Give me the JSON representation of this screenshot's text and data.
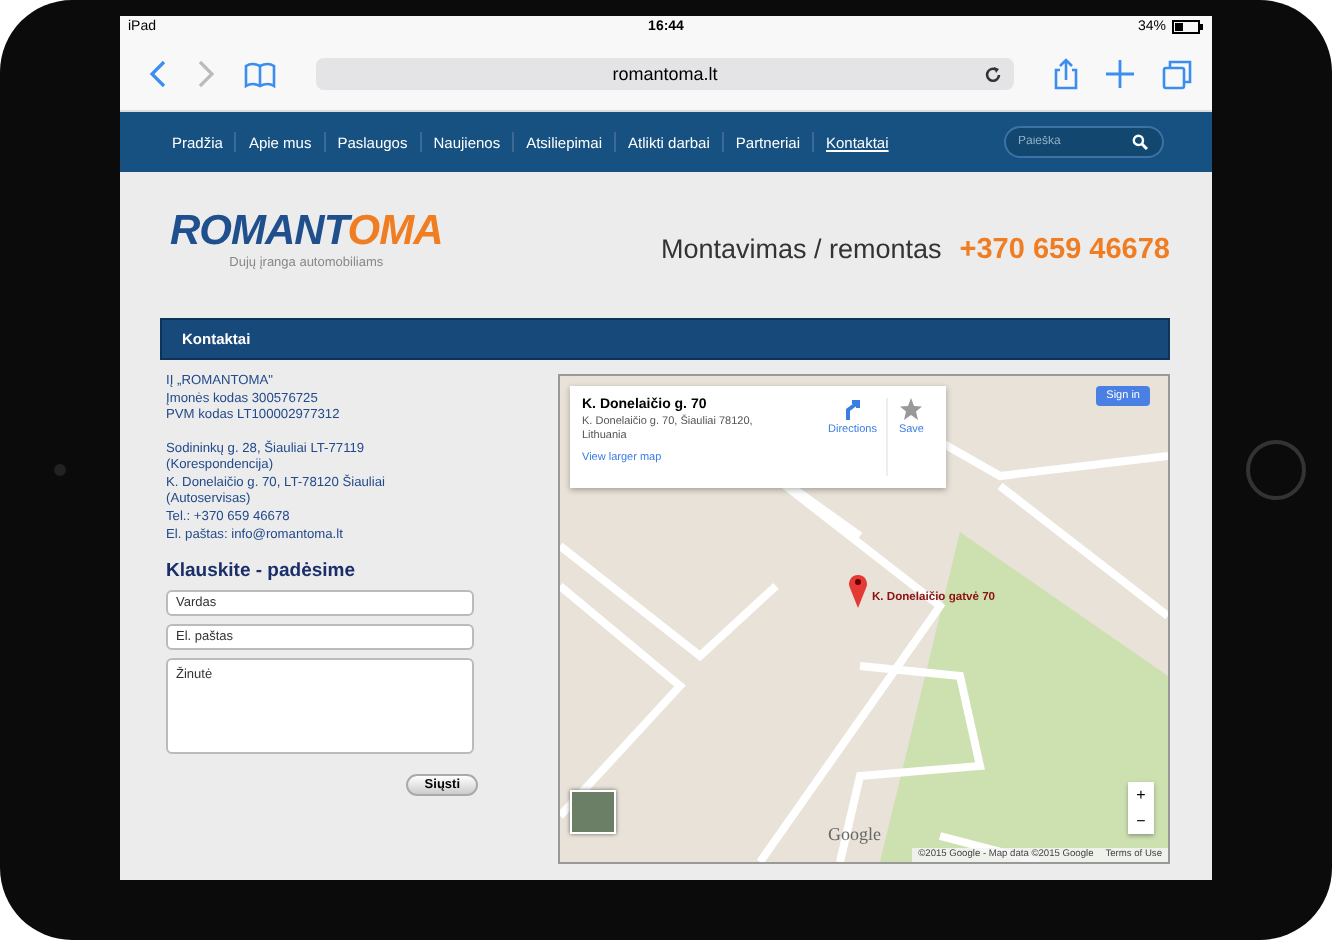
{
  "status_bar": {
    "device": "iPad",
    "time": "16:44",
    "battery": "34%"
  },
  "browser": {
    "url": "romantoma.lt"
  },
  "nav": {
    "items": [
      {
        "label": "Pradžia",
        "selected": false
      },
      {
        "label": "Apie mus",
        "selected": false
      },
      {
        "label": "Paslaugos",
        "selected": false
      },
      {
        "label": "Naujienos",
        "selected": false
      },
      {
        "label": "Atsiliepimai",
        "selected": false
      },
      {
        "label": "Atlikti darbai",
        "selected": false
      },
      {
        "label": "Partneriai",
        "selected": false
      },
      {
        "label": "Kontaktai",
        "selected": true
      }
    ],
    "search": {
      "placeholder": "Paieška"
    }
  },
  "header": {
    "logo": {
      "text_primary": "ROMANT",
      "text_accent": "OMA",
      "tagline": "Dujų įranga automobiliams"
    },
    "slogan": "Montavimas / remontas",
    "phone": "+370 659 46678"
  },
  "section": {
    "title": "Kontaktai"
  },
  "contacts": [
    [
      "IĮ „ROMANTOMA\"",
      "Įmonės kodas 300576725",
      "PVM kodas LT100002977312"
    ],
    [
      "Sodininkų g. 28, Šiauliai LT-77119",
      "(Korespondencija)",
      "K. Donelaičio g. 70, LT-78120 Šiauliai",
      "(Autoservisas)",
      "Tel.: +370 659 46678",
      "El. paštas: info@romantoma.lt"
    ]
  ],
  "form": {
    "title": "Klauskite - padėsime",
    "fields": [
      {
        "kind": "input",
        "placeholder": "Vardas"
      },
      {
        "kind": "input",
        "placeholder": "El. paštas"
      },
      {
        "kind": "textarea",
        "placeholder": "Žinutė"
      }
    ],
    "button": "Siųsti"
  },
  "map": {
    "card": {
      "title": "K. Donelaičio g. 70",
      "address": [
        "K. Donelaičio g. 70, Šiauliai 78120,",
        "Lithuania"
      ],
      "link": "View larger map",
      "actions": [
        "Directions",
        "Save"
      ]
    },
    "sign_in": "Sign in",
    "pin_label": "K. Donelaičio gatvė 70",
    "zoom": [
      "+",
      "−"
    ],
    "brand": "Google",
    "attribution": "©2015 Google - Map data ©2015 Google",
    "terms": "Terms of Use"
  }
}
